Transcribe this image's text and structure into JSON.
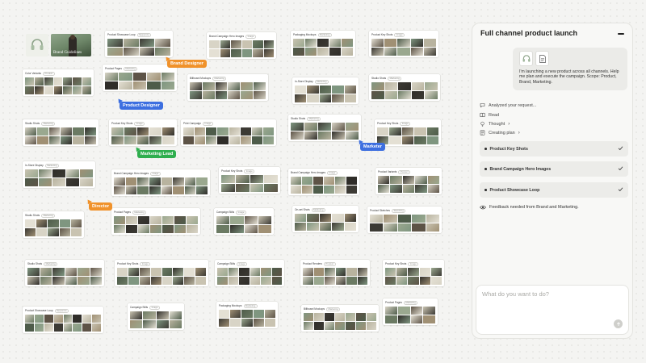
{
  "canvas": {
    "brand_guidelines_label": "Brand Guidelines",
    "boards": [
      {
        "title": "Product Showcase Loop",
        "chip": "Sequence"
      },
      {
        "title": "Brand Campaign Hero Images",
        "chip": "Image"
      },
      {
        "title": "Packaging Mockups",
        "chip": "Marketing"
      },
      {
        "title": "Product Key Shots",
        "chip": "Image"
      },
      {
        "title": "Color Variants",
        "chip": "Product"
      },
      {
        "title": "Product Pages",
        "chip": "Marketing"
      },
      {
        "title": "Billboard Mockups",
        "chip": "Marketing"
      },
      {
        "title": "In-Store Display",
        "chip": "Marketing"
      },
      {
        "title": "Studio Shots",
        "chip": "Marketing"
      },
      {
        "title": "Studio Shots",
        "chip": "Marketing"
      },
      {
        "title": "Product Key Shots",
        "chip": "Image"
      },
      {
        "title": "Print Campaign",
        "chip": "Image"
      },
      {
        "title": "Studio Shots",
        "chip": "Marketing"
      },
      {
        "title": "Product Key Shots",
        "chip": "Image"
      },
      {
        "title": "In-Store Display",
        "chip": "Marketing"
      },
      {
        "title": "Brand Campaign Hero Images",
        "chip": "Image"
      },
      {
        "title": "Product Key Shots",
        "chip": "Image"
      },
      {
        "title": "Brand Campaign Hero Images",
        "chip": "Image"
      },
      {
        "title": "Product Variants",
        "chip": "Product"
      },
      {
        "title": "Studio Shots",
        "chip": "Marketing"
      },
      {
        "title": "Product Pages",
        "chip": "Marketing"
      },
      {
        "title": "Campaign Stills",
        "chip": "Image"
      },
      {
        "title": "On-set Shots",
        "chip": "Marketing"
      },
      {
        "title": "Product Sketches",
        "chip": "Sketching"
      },
      {
        "title": "Studio Shots",
        "chip": "Marketing"
      },
      {
        "title": "Product Key Shots",
        "chip": "Image"
      },
      {
        "title": "Campaign Stills",
        "chip": "Image"
      },
      {
        "title": "Product Renders",
        "chip": "Product"
      },
      {
        "title": "Product Key Shots",
        "chip": "Image"
      },
      {
        "title": "Product Showcase Loop",
        "chip": "Sequence"
      },
      {
        "title": "Campaign Stills",
        "chip": "Image"
      },
      {
        "title": "Packaging Mockups",
        "chip": "Marketing"
      },
      {
        "title": "Billboard Mockups",
        "chip": "Marketing"
      },
      {
        "title": "Product Pages",
        "chip": "Marketing"
      }
    ],
    "tags": [
      {
        "label": "Brand Designer",
        "color": "#f0922b"
      },
      {
        "label": "Product Designer",
        "color": "#3d6fe0"
      },
      {
        "label": "Marketing Lead",
        "color": "#2fae4e"
      },
      {
        "label": "Marketer",
        "color": "#3d6fe0"
      },
      {
        "label": "Director",
        "color": "#f0922b"
      }
    ]
  },
  "panel": {
    "title": "Full channel product launch",
    "user_message": "I'm launching a new product across all channels. Help me plan and execute the campaign. Scope: Product, Brand, Marketing.",
    "steps": {
      "analyzed": "Analyzed your request...",
      "read": "Read",
      "thought": "Thought",
      "creating_plan": "Creating plan"
    },
    "plan_items": [
      {
        "label": "Product Key Shots"
      },
      {
        "label": "Brand Campaign Hero Images"
      },
      {
        "label": "Product Showcase Loop"
      }
    ],
    "feedback": "Feedback needed from Brand and Marketing.",
    "input_placeholder": "What do you want to do?"
  }
}
